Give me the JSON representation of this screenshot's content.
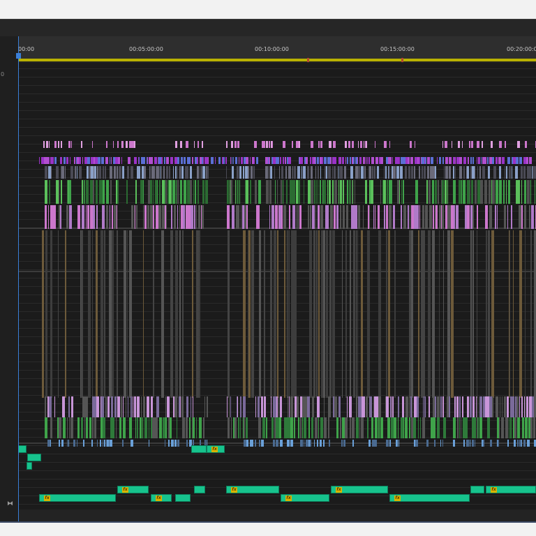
{
  "timeline": {
    "ruler": {
      "ticks": [
        "00:00",
        "00:05:00:00",
        "00:10:00:00",
        "00:15:00:00",
        "00:20:00:00"
      ],
      "side_label": "0"
    },
    "clip_badge": "fx",
    "snap_icon": "bow-tie-snap-icon",
    "colors": {
      "panel_bg": "#232323",
      "work_area": "#b9b200",
      "playhead": "#3a7fd8",
      "audio_clip": "#17c38d",
      "fx_badge": "#d9b300",
      "video_pink": "#cc77cc",
      "video_purple": "#9a33c6",
      "video_green": "#3fa34a",
      "video_blue": "#6aa0d8"
    }
  }
}
